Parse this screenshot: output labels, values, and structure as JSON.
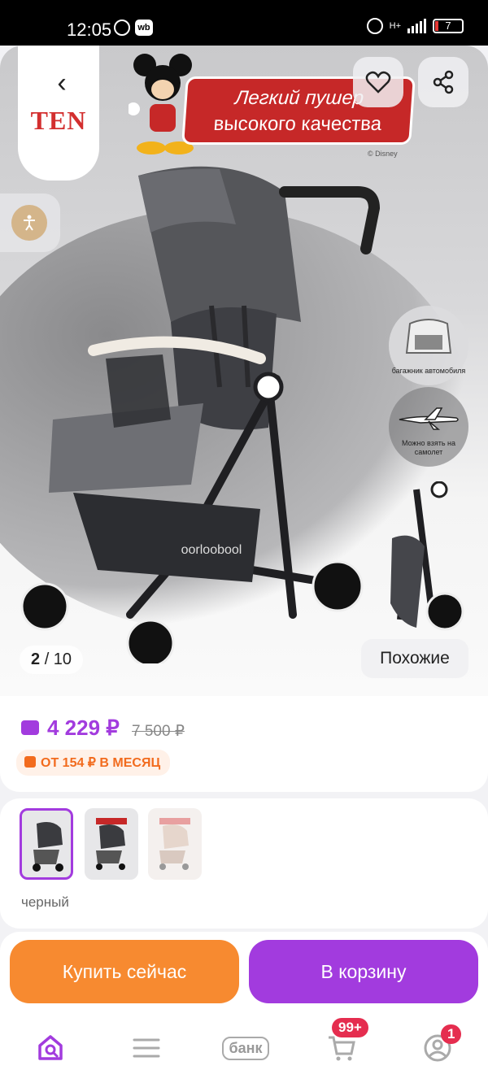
{
  "status_bar": {
    "time": "12:05",
    "network": "H+",
    "battery": "7"
  },
  "brand": {
    "logo": "TEN"
  },
  "promo": {
    "line1": "Легкий пушер",
    "line2": "высокого качества",
    "copyright": "© Disney"
  },
  "features": [
    {
      "icon": "car-trunk-icon",
      "label": "багажник автомобиля"
    },
    {
      "icon": "airplane-icon",
      "label": "Можно взять на самолет"
    }
  ],
  "gallery": {
    "current": "2",
    "total": "/ 10",
    "similar_label": "Похожие",
    "stroller_logo": "oorloobool"
  },
  "price": {
    "current": "4 229 ₽",
    "old": "7 500 ₽",
    "installment": "ОТ 154 ₽ В МЕСЯЦ"
  },
  "variants": {
    "selected_label": "черный",
    "count": 3
  },
  "actions": {
    "buy_now": "Купить сейчас",
    "add_to_cart": "В корзину"
  },
  "bottom_nav": {
    "home_icon": "home-search-icon",
    "catalog_icon": "menu-icon",
    "bank_label": "банк",
    "cart_badge": "99+",
    "profile_badge": "1"
  },
  "colors": {
    "accent": "#a23bde",
    "buy": "#f78a30",
    "badge": "#e52d4f",
    "installment": "#f26b1d"
  }
}
